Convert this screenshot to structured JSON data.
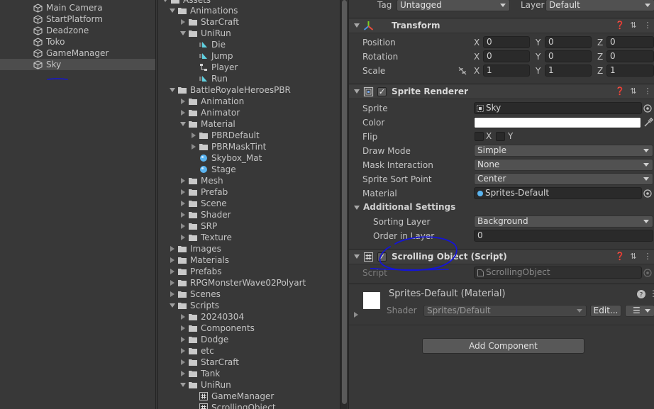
{
  "hierarchy": {
    "items": [
      {
        "label": "Main Camera",
        "selected": false
      },
      {
        "label": "StartPlatform",
        "selected": false
      },
      {
        "label": "Deadzone",
        "selected": false
      },
      {
        "label": "Toko",
        "selected": false
      },
      {
        "label": "GameManager",
        "selected": false
      },
      {
        "label": "Sky",
        "selected": true
      }
    ]
  },
  "project": {
    "root_label": "Assets",
    "items": [
      {
        "label": "Animations",
        "depth": 1,
        "type": "folder",
        "open": true
      },
      {
        "label": "StarCraft",
        "depth": 2,
        "type": "folder",
        "open": false
      },
      {
        "label": "UniRun",
        "depth": 2,
        "type": "folder",
        "open": true
      },
      {
        "label": "Die",
        "depth": 3,
        "type": "anim"
      },
      {
        "label": "Jump",
        "depth": 3,
        "type": "anim"
      },
      {
        "label": "Player",
        "depth": 3,
        "type": "controller"
      },
      {
        "label": "Run",
        "depth": 3,
        "type": "anim"
      },
      {
        "label": "BattleRoyaleHeroesPBR",
        "depth": 1,
        "type": "folder",
        "open": true
      },
      {
        "label": "Animation",
        "depth": 2,
        "type": "folder",
        "open": false
      },
      {
        "label": "Animator",
        "depth": 2,
        "type": "folder",
        "open": false
      },
      {
        "label": "Material",
        "depth": 2,
        "type": "folder",
        "open": true
      },
      {
        "label": "PBRDefault",
        "depth": 3,
        "type": "folder",
        "open": false
      },
      {
        "label": "PBRMaskTint",
        "depth": 3,
        "type": "folder",
        "open": false
      },
      {
        "label": "Skybox_Mat",
        "depth": 3,
        "type": "material"
      },
      {
        "label": "Stage",
        "depth": 3,
        "type": "material"
      },
      {
        "label": "Mesh",
        "depth": 2,
        "type": "folder",
        "open": false
      },
      {
        "label": "Prefab",
        "depth": 2,
        "type": "folder",
        "open": false
      },
      {
        "label": "Scene",
        "depth": 2,
        "type": "folder",
        "open": false
      },
      {
        "label": "Shader",
        "depth": 2,
        "type": "folder",
        "open": false
      },
      {
        "label": "SRP",
        "depth": 2,
        "type": "folder",
        "open": false
      },
      {
        "label": "Texture",
        "depth": 2,
        "type": "folder",
        "open": false
      },
      {
        "label": "Images",
        "depth": 1,
        "type": "folder",
        "open": false
      },
      {
        "label": "Materials",
        "depth": 1,
        "type": "folder",
        "open": false
      },
      {
        "label": "Prefabs",
        "depth": 1,
        "type": "folder",
        "open": false
      },
      {
        "label": "RPGMonsterWave02Polyart",
        "depth": 1,
        "type": "folder",
        "open": false
      },
      {
        "label": "Scenes",
        "depth": 1,
        "type": "folder",
        "open": false
      },
      {
        "label": "Scripts",
        "depth": 1,
        "type": "folder",
        "open": true
      },
      {
        "label": "20240304",
        "depth": 2,
        "type": "folder",
        "open": false
      },
      {
        "label": "Components",
        "depth": 2,
        "type": "folder",
        "open": false
      },
      {
        "label": "Dodge",
        "depth": 2,
        "type": "folder",
        "open": false
      },
      {
        "label": "etc",
        "depth": 2,
        "type": "folder",
        "open": false
      },
      {
        "label": "StarCraft",
        "depth": 2,
        "type": "folder",
        "open": false
      },
      {
        "label": "Tank",
        "depth": 2,
        "type": "folder",
        "open": false
      },
      {
        "label": "UniRun",
        "depth": 2,
        "type": "folder",
        "open": true
      },
      {
        "label": "GameManager",
        "depth": 3,
        "type": "script"
      },
      {
        "label": "ScrollingObject",
        "depth": 3,
        "type": "script"
      }
    ]
  },
  "inspector": {
    "tag_label": "Tag",
    "tag_value": "Untagged",
    "layer_label": "Layer",
    "layer_value": "Default",
    "transform": {
      "title": "Transform",
      "position_label": "Position",
      "rotation_label": "Rotation",
      "scale_label": "Scale",
      "axis_x": "X",
      "axis_y": "Y",
      "axis_z": "Z",
      "position": [
        "0",
        "0",
        "0"
      ],
      "rotation": [
        "0",
        "0",
        "0"
      ],
      "scale": [
        "1",
        "1",
        "1"
      ]
    },
    "sprite_renderer": {
      "title": "Sprite Renderer",
      "sprite_label": "Sprite",
      "sprite_value": "Sky",
      "color_label": "Color",
      "color_value": "#ffffff",
      "flip_label": "Flip",
      "flip_x": "X",
      "flip_y": "Y",
      "draw_mode_label": "Draw Mode",
      "draw_mode_value": "Simple",
      "mask_label": "Mask Interaction",
      "mask_value": "None",
      "sort_point_label": "Sprite Sort Point",
      "sort_point_value": "Center",
      "material_label": "Material",
      "material_value": "Sprites-Default",
      "additional_label": "Additional Settings",
      "sorting_layer_label": "Sorting Layer",
      "sorting_layer_value": "Background",
      "order_label": "Order in Layer",
      "order_value": "0"
    },
    "scrolling_object": {
      "title": "Scrolling Object (Script)",
      "script_label": "Script",
      "script_value": "ScrollingObject"
    },
    "material": {
      "title": "Sprites-Default (Material)",
      "shader_label": "Shader",
      "shader_value": "Sprites/Default",
      "edit_label": "Edit..."
    },
    "add_component_label": "Add Component"
  },
  "colors": {
    "annotation_blue": "#1414d8",
    "folder": "#c9c9c9",
    "anim_icon": "#5fd0e0",
    "material_icon": "#5ab4f0"
  }
}
